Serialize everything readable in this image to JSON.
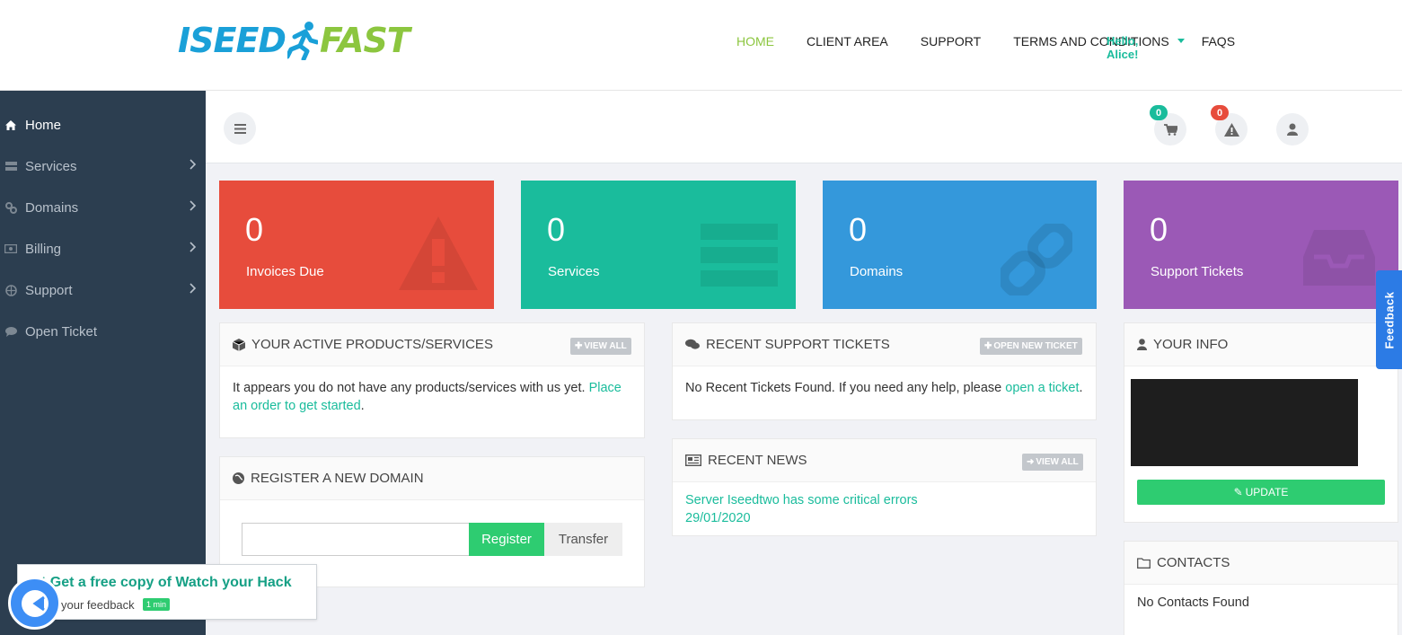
{
  "brand": {
    "part1": "ISEED",
    "part2": "FAST"
  },
  "topnav": [
    {
      "label": "HOME",
      "active": true
    },
    {
      "label": "CLIENT AREA",
      "active": false
    },
    {
      "label": "SUPPORT",
      "active": false
    },
    {
      "label": "TERMS AND CONDITIONS",
      "active": false
    },
    {
      "label": "FAQS",
      "active": false
    }
  ],
  "sidebar": {
    "items": [
      {
        "label": "Home",
        "icon": "home-icon",
        "active": true
      },
      {
        "label": "Services",
        "icon": "server-icon"
      },
      {
        "label": "Domains",
        "icon": "link-icon"
      },
      {
        "label": "Billing",
        "icon": "money-icon"
      },
      {
        "label": "Support",
        "icon": "globe-icon"
      },
      {
        "label": "Open Ticket",
        "icon": "comment-icon"
      }
    ]
  },
  "header": {
    "cart_count": "0",
    "alerts_count": "0",
    "greeting": "Hello, Alice!"
  },
  "tiles": [
    {
      "value": "0",
      "label": "Invoices Due",
      "color": "#e74c3c",
      "icon": "warning-icon"
    },
    {
      "value": "0",
      "label": "Services",
      "color": "#1abc9c",
      "icon": "server-icon"
    },
    {
      "value": "0",
      "label": "Domains",
      "color": "#3498db",
      "icon": "link-icon"
    },
    {
      "value": "0",
      "label": "Support Tickets",
      "color": "#9b59b6",
      "icon": "inbox-icon"
    }
  ],
  "products_panel": {
    "title": "YOUR ACTIVE PRODUCTS/SERVICES",
    "action": "VIEW ALL",
    "text": "It appears you do not have any products/services with us yet.",
    "link": "Place an order to get started",
    "suffix": "."
  },
  "domain_panel": {
    "title": "REGISTER A NEW DOMAIN",
    "input_placeholder": "",
    "register_label": "Register",
    "transfer_label": "Transfer"
  },
  "tickets_panel": {
    "title": "RECENT SUPPORT TICKETS",
    "action": "OPEN NEW TICKET",
    "text": "No Recent Tickets Found. If you need any help, please",
    "link": "open a ticket",
    "suffix": "."
  },
  "news_panel": {
    "title": "RECENT NEWS",
    "action": "VIEW ALL",
    "item_title": "Server Iseedtwo has some critical errors",
    "item_date": "29/01/2020"
  },
  "info_panel": {
    "title": "YOUR INFO",
    "update_label": "UPDATE"
  },
  "contacts_panel": {
    "title": "CONTACTS",
    "text": "No Contacts Found"
  },
  "feedback_tab": "Feedback",
  "promo": {
    "title": "t Get a free copy of Watch your Hack",
    "sub": "your feedback",
    "badge": "1 min"
  },
  "colors": {
    "accent": "#1abc9c",
    "brand_blue": "#1aa0d8",
    "brand_green": "#8cc63f",
    "sidebar": "#2c3e50"
  }
}
